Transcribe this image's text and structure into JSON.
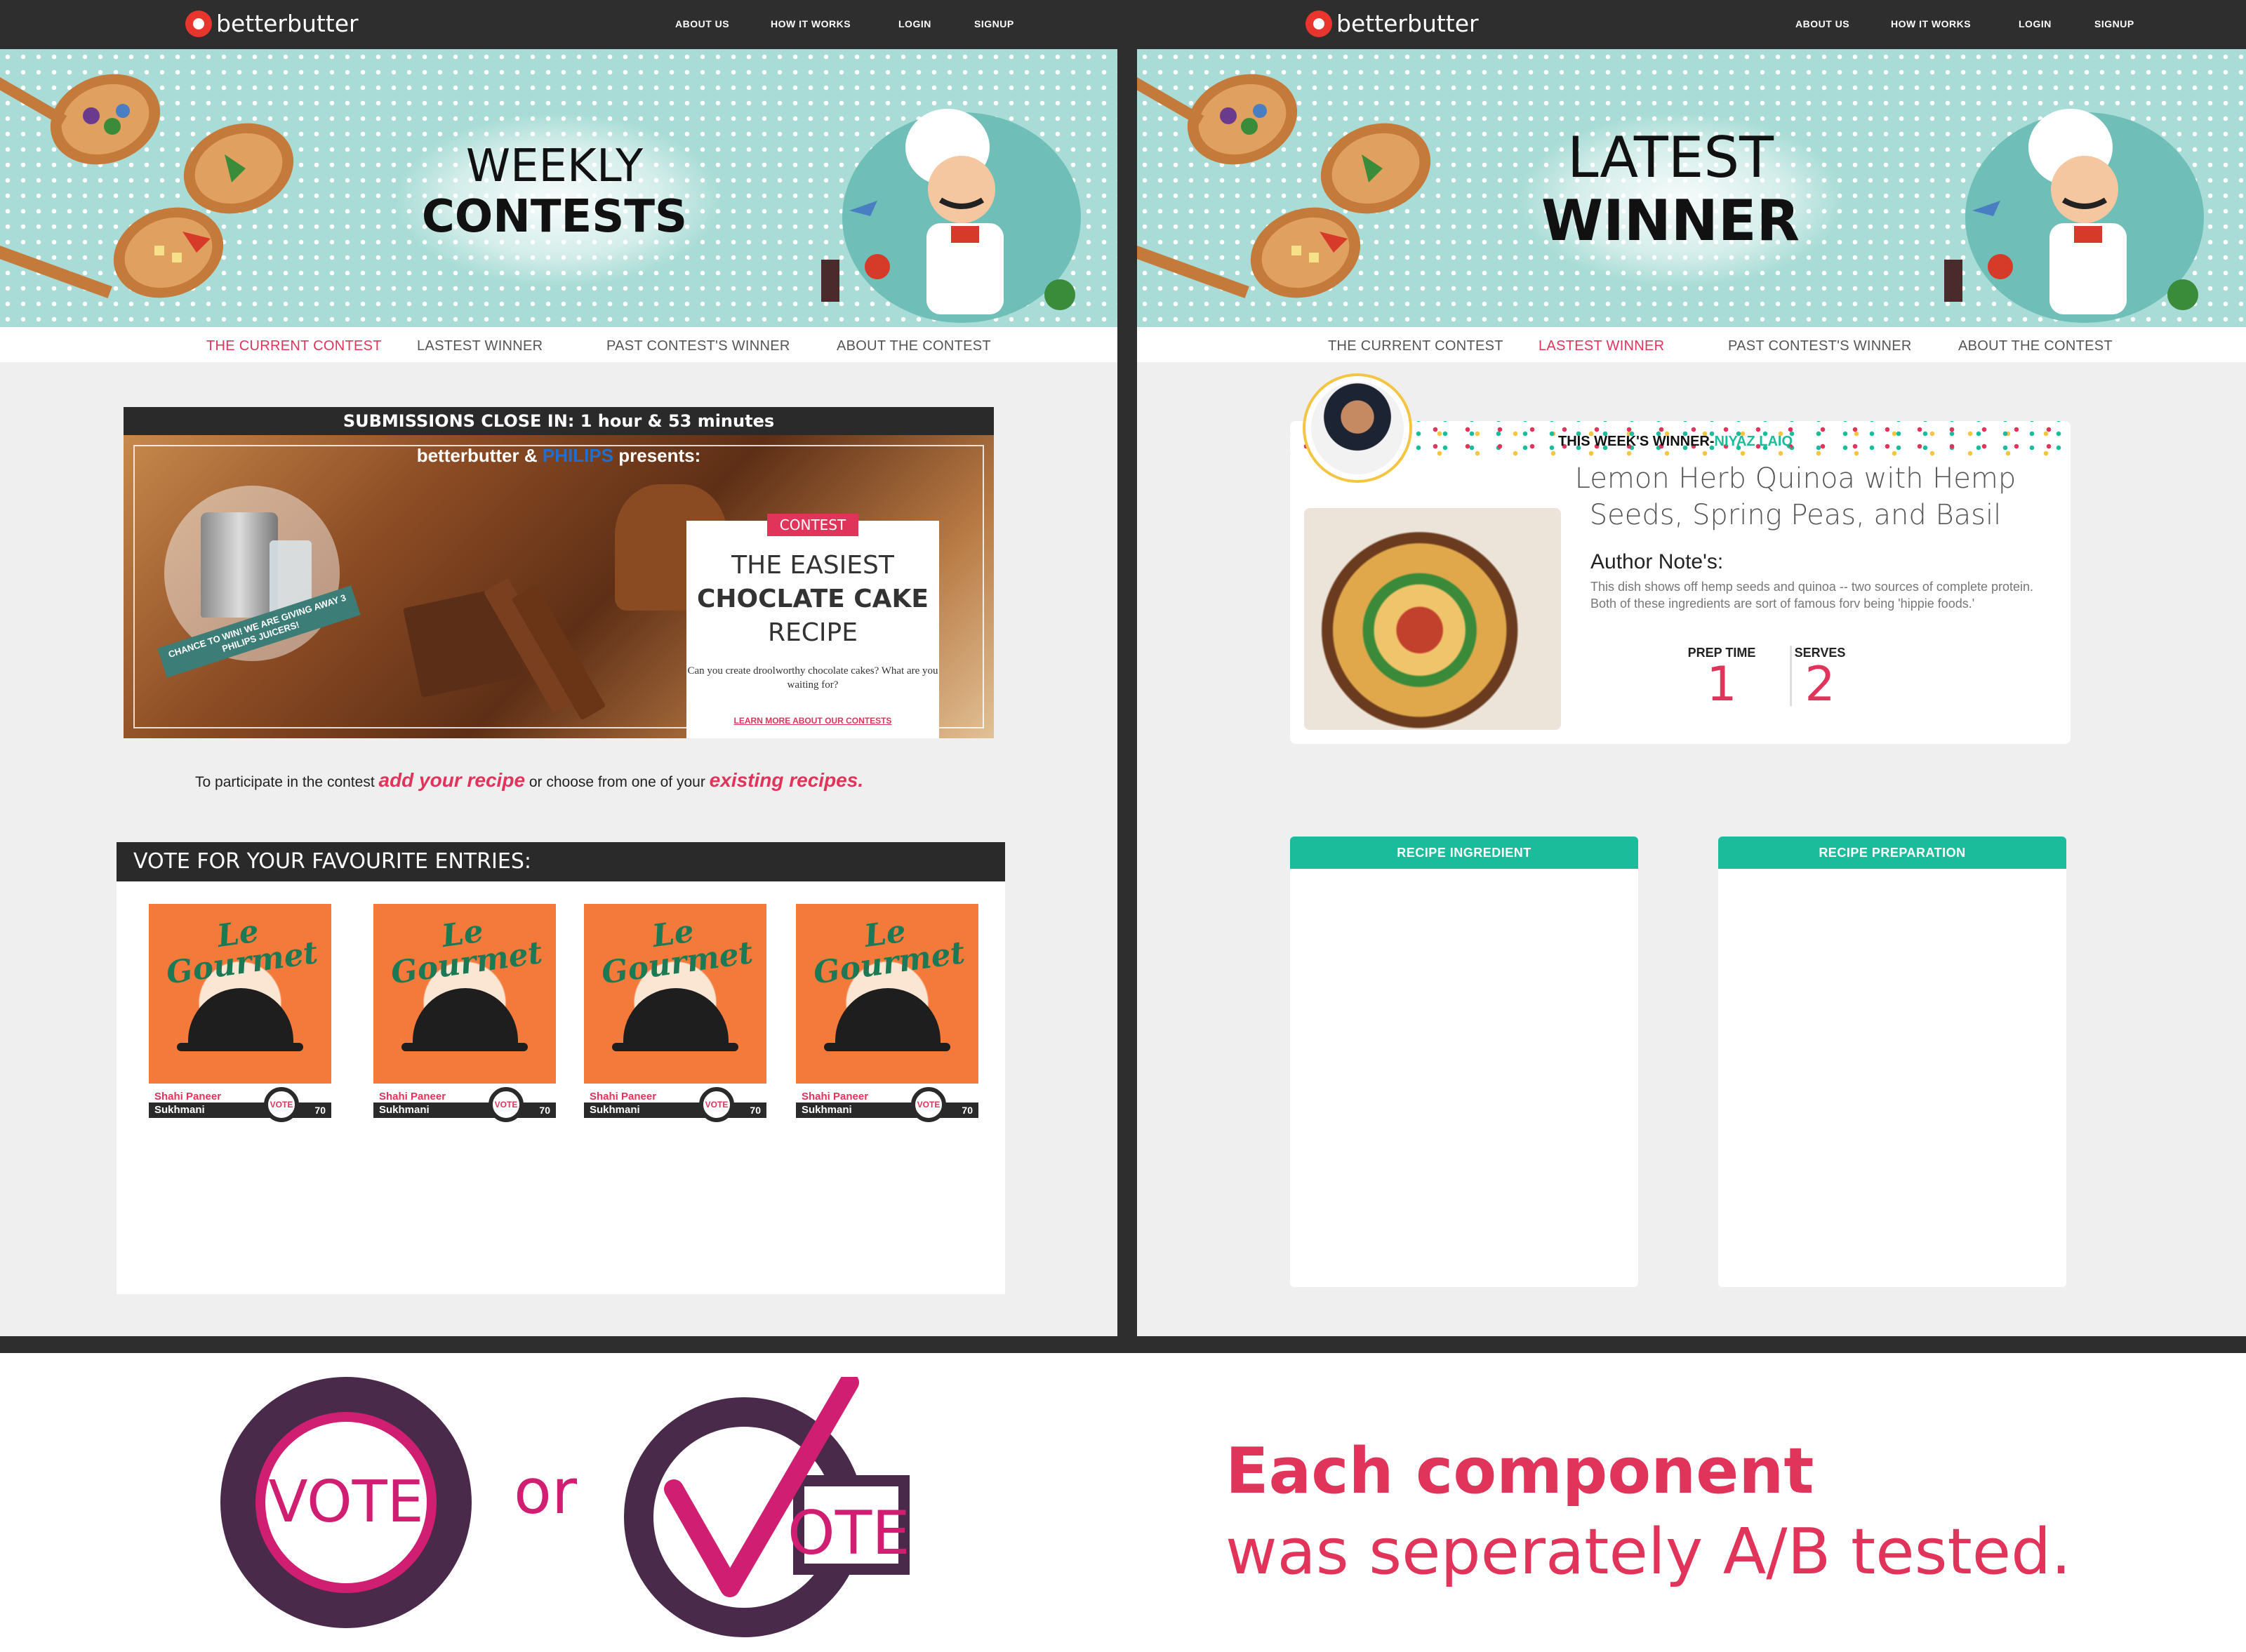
{
  "left_panel": {
    "logo": "betterbutter",
    "nav": [
      "ABOUT US",
      "HOW IT WORKS",
      "LOGIN",
      "SIGNUP"
    ],
    "hero_title": [
      "WEEKLY",
      "CONTESTS"
    ],
    "subnav": [
      "THE CURRENT CONTEST",
      "LASTEST WINNER",
      "PAST CONTEST'S WINNER",
      "ABOUT THE CONTEST"
    ],
    "countdown": "SUBMISSIONS CLOSE IN: 1 hour & 53 minutes",
    "banner": {
      "brand1": "betterbutter",
      "amp": "&",
      "brand2": "PHILIPS",
      "presents": "presents:",
      "ribbon": "CHANCE TO WIN! WE ARE GIVING AWAY 3 PHILIPS JUICERS!",
      "tag": "CONTEST",
      "line1": "THE EASIEST",
      "line2": "CHOCLATE CAKE",
      "line3": "RECIPE",
      "question": "Can you create droolworthy chocolate cakes? What are you waiting for?",
      "link": "LEARN MORE ABOUT OUR CONTESTS"
    },
    "participate": {
      "pre": "To participate in the contest",
      "link1": "add your recipe",
      "mid": "or choose from one of your",
      "link2": "existing recipes."
    },
    "vote_header": "VOTE FOR YOUR FAVOURITE ENTRIES:",
    "entries": [
      {
        "image_title": "Le Gourmet",
        "name": "Shahi Paneer",
        "author": "Sukhmani",
        "vote": "VOTE",
        "votes": "70"
      },
      {
        "image_title": "Le Gourmet",
        "name": "Shahi Paneer",
        "author": "Sukhmani",
        "vote": "VOTE",
        "votes": "70"
      },
      {
        "image_title": "Le Gourmet",
        "name": "Shahi Paneer",
        "author": "Sukhmani",
        "vote": "VOTE",
        "votes": "70"
      },
      {
        "image_title": "Le Gourmet",
        "name": "Shahi Paneer",
        "author": "Sukhmani",
        "vote": "VOTE",
        "votes": "70"
      }
    ]
  },
  "right_panel": {
    "logo": "betterbutter",
    "nav": [
      "ABOUT US",
      "HOW IT WORKS",
      "LOGIN",
      "SIGNUP"
    ],
    "hero_title": [
      "LATEST",
      "WINNER"
    ],
    "subnav": [
      "THE CURRENT CONTEST",
      "LASTEST WINNER",
      "PAST CONTEST'S WINNER",
      "ABOUT THE CONTEST"
    ],
    "winner_prefix": "THIS WEEK'S WINNER-",
    "winner_name": "NIYAZ LAIQ",
    "recipe_title": "Lemon Herb Quinoa with Hemp Seeds, Spring Peas, and Basil",
    "author_heading": "Author Note's:",
    "author_note": "This dish shows off hemp seeds and quinoa -- two sources of complete protein. Both of these ingredients are sort of famous forv being 'hippie foods.'",
    "prep_label": "PREP TIME",
    "prep_value": "1",
    "serves_label": "SERVES",
    "serves_value": "2",
    "col_ingredient": "RECIPE INGREDIENT",
    "col_preparation": "RECIPE PREPARATION"
  },
  "bottom": {
    "vote_a": "VOTE",
    "or": "or",
    "vote_b": "OTE",
    "line1": "Each component",
    "line2": "was seperately A/B tested."
  },
  "colors": {
    "accent": "#e0345a",
    "teal": "#1bbc9b",
    "dark": "#2e2e2e",
    "hero_bg": "#a9dcd6",
    "vote_purple": "#4a2a4a",
    "vote_magenta": "#d01f72"
  }
}
